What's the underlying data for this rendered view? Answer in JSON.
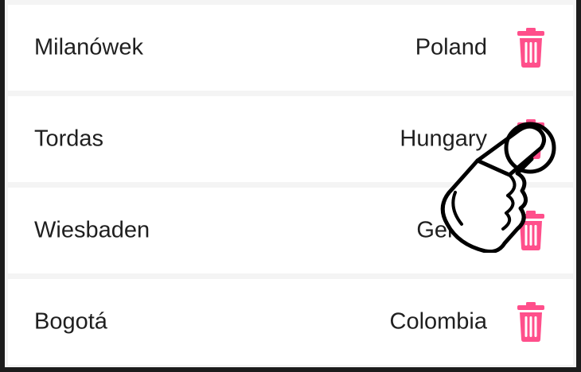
{
  "colors": {
    "accent": "#ff4f8b",
    "text": "#1f1f1f",
    "background": "#f4f4f4",
    "row": "#ffffff",
    "frame": "#1c1c1c"
  },
  "rows": [
    {
      "city": "Milanówek",
      "country": "Poland",
      "icon": "trash-icon"
    },
    {
      "city": "Tordas",
      "country": "Hungary",
      "icon": "trash-icon"
    },
    {
      "city": "Wiesbaden",
      "country": "Germa",
      "icon": "trash-icon"
    },
    {
      "city": "Bogotá",
      "country": "Colombia",
      "icon": "trash-icon"
    }
  ],
  "overlay": {
    "icon": "pointing-hand-icon"
  }
}
